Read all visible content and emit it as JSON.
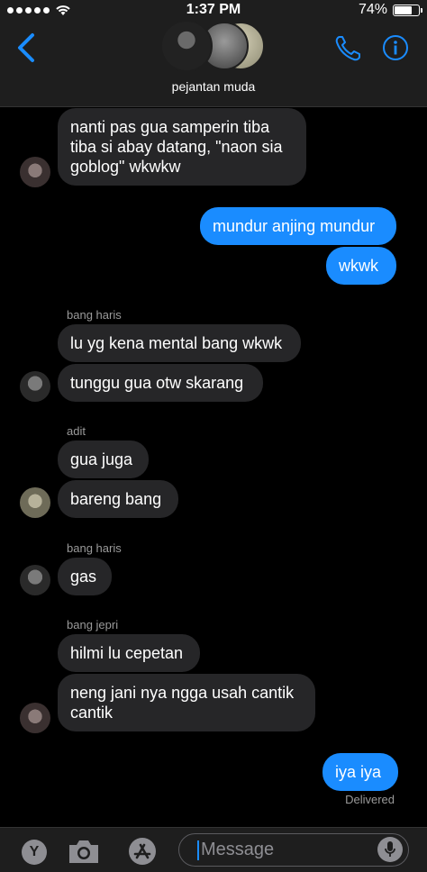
{
  "status_bar": {
    "time": "1:37 PM",
    "battery": "74%",
    "battery_level": 0.74
  },
  "header": {
    "group_name": "pejantan muda",
    "back_icon": "chevron-left-icon",
    "call_icon": "phone-icon",
    "info_icon": "info-icon"
  },
  "messages": [
    {
      "text": "nanti pas gua samperin tiba tiba si abay datang, \"naon sia goblog\" wkwkw"
    },
    {
      "text": "mundur anjing mundur"
    },
    {
      "text": "wkwk"
    },
    {
      "sender": "bang haris",
      "text": "lu yg kena mental bang wkwk"
    },
    {
      "text": "tunggu gua otw skarang"
    },
    {
      "sender": "adit",
      "text": "gua juga"
    },
    {
      "text": "bareng bang"
    },
    {
      "sender": "bang haris",
      "text": "gas"
    },
    {
      "sender": "bang jepri",
      "text": "hilmi lu cepetan"
    },
    {
      "text": "neng jani nya ngga usah cantik cantik"
    },
    {
      "text": "iya iya",
      "status": "Delivered"
    }
  ],
  "composer": {
    "placeholder": "Message",
    "app_y_label": "Y"
  }
}
